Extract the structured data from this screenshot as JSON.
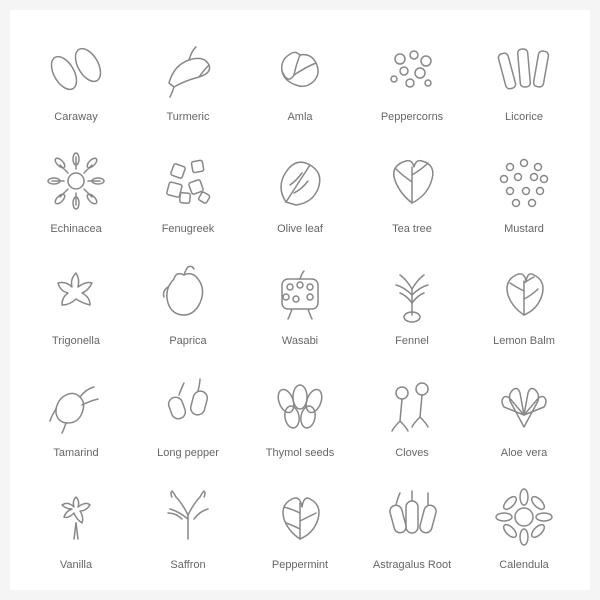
{
  "herbs": [
    {
      "name": "Caraway",
      "id": "caraway"
    },
    {
      "name": "Turmeric",
      "id": "turmeric"
    },
    {
      "name": "Amla",
      "id": "amla"
    },
    {
      "name": "Peppercorns",
      "id": "peppercorns"
    },
    {
      "name": "Licorice",
      "id": "licorice"
    },
    {
      "name": "Echinacea",
      "id": "echinacea"
    },
    {
      "name": "Fenugreek",
      "id": "fenugreek"
    },
    {
      "name": "Olive leaf",
      "id": "olive-leaf"
    },
    {
      "name": "Tea tree",
      "id": "tea-tree"
    },
    {
      "name": "Mustard",
      "id": "mustard"
    },
    {
      "name": "Trigonella",
      "id": "trigonella"
    },
    {
      "name": "Paprica",
      "id": "paprica"
    },
    {
      "name": "Wasabi",
      "id": "wasabi"
    },
    {
      "name": "Fennel",
      "id": "fennel"
    },
    {
      "name": "Lemon Balm",
      "id": "lemon-balm"
    },
    {
      "name": "Tamarind",
      "id": "tamarind"
    },
    {
      "name": "Long pepper",
      "id": "long-pepper"
    },
    {
      "name": "Thymol seeds",
      "id": "thymol-seeds"
    },
    {
      "name": "Cloves",
      "id": "cloves"
    },
    {
      "name": "Aloe vera",
      "id": "aloe-vera"
    },
    {
      "name": "Vanilla",
      "id": "vanilla"
    },
    {
      "name": "Saffron",
      "id": "saffron"
    },
    {
      "name": "Peppermint",
      "id": "peppermint"
    },
    {
      "name": "Astragalus Root",
      "id": "astragalus-root"
    },
    {
      "name": "Calendula",
      "id": "calendula"
    }
  ]
}
